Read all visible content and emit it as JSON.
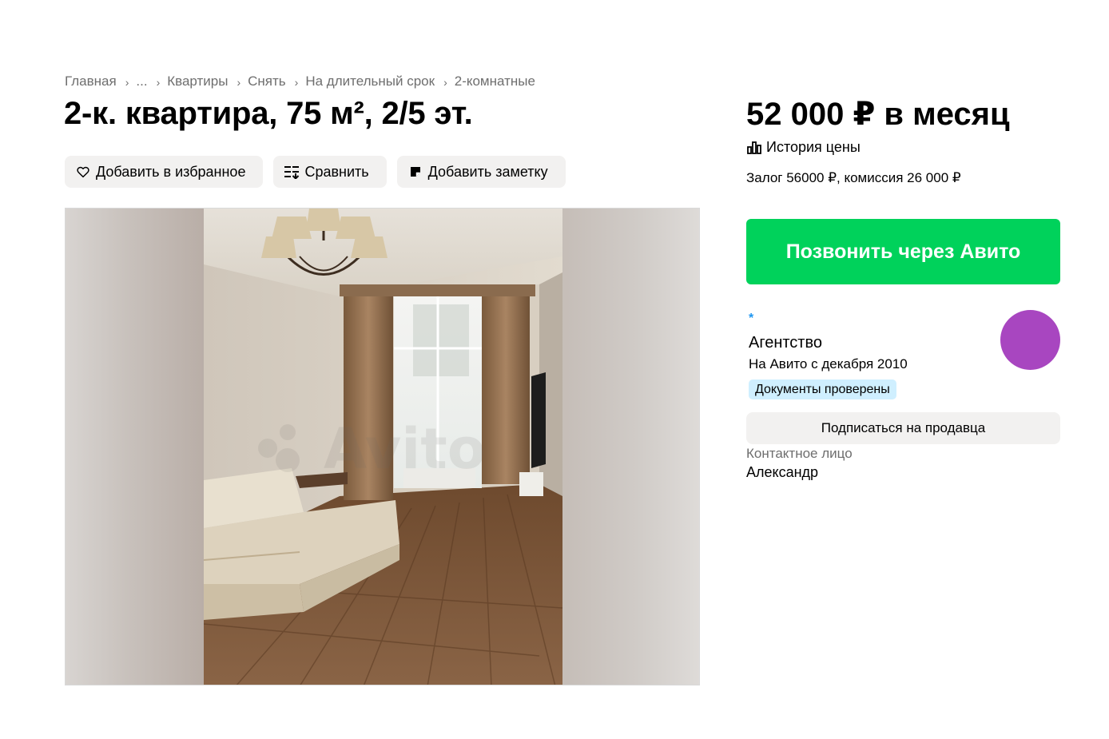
{
  "breadcrumb": [
    {
      "label": "Главная"
    },
    {
      "label": "..."
    },
    {
      "label": "Квартиры"
    },
    {
      "label": "Снять"
    },
    {
      "label": "На длительный срок"
    },
    {
      "label": "2-комнатные"
    }
  ],
  "breadcrumb_separator": "›",
  "title": "2-к. квартира, 75 м², 2/5 эт.",
  "actions": {
    "favorite": "Добавить в избранное",
    "compare": "Сравнить",
    "note": "Добавить заметку"
  },
  "price": "52 000 ₽ в месяц",
  "price_history": "История цены",
  "deposit": "Залог 56000 ₽, комиссия 26 000 ₽",
  "call_button": "Позвонить через Авито",
  "seller": {
    "marker": "*",
    "type": "Агентство",
    "since": "На Авито с декабря 2010",
    "badge": "Документы проверены",
    "avatar_color": "#a846c0"
  },
  "subscribe_button": "Подписаться на продавца",
  "contact": {
    "label": "Контактное лицо",
    "name": "Александр"
  },
  "colors": {
    "call_button": "#00d25b",
    "badge": "#cfefff",
    "button_bg": "#f2f1f0"
  }
}
